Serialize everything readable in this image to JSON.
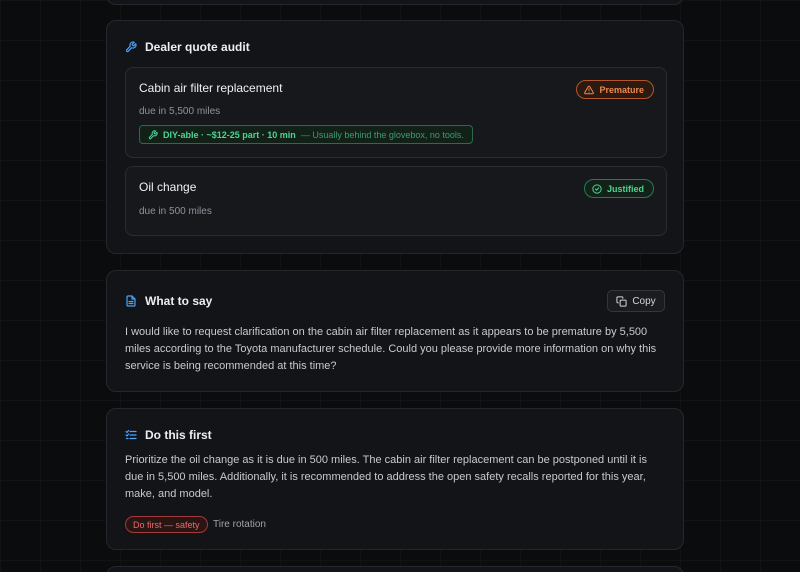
{
  "audit": {
    "title": "Dealer quote audit",
    "items": [
      {
        "title": "Cabin air filter replacement",
        "due": "due in 5,500 miles",
        "badge": "Premature",
        "diy_main": "DIY-able · ~$12-25 part · 10 min",
        "diy_note": "— Usually behind the glovebox, no tools."
      },
      {
        "title": "Oil change",
        "due": "due in 500 miles",
        "badge": "Justified"
      }
    ]
  },
  "say": {
    "title": "What to say",
    "copy_label": "Copy",
    "text": "I would like to request clarification on the cabin air filter replacement as it appears to be premature by 5,500 miles according to the Toyota manufacturer schedule. Could you please provide more information on why this service is being recommended at this time?"
  },
  "first": {
    "title": "Do this first",
    "text": "Prioritize the oil change as it is due in 500 miles. The cabin air filter replacement can be postponed until it is due in 5,500 miles. Additionally, it is recommended to address the open safety recalls reported for this year, make, and model.",
    "tags": [
      "Do first — safety",
      "Tire rotation"
    ]
  },
  "colors": {
    "accent": "#4aa3ff",
    "warning": "#f0884f",
    "success": "#4ed391",
    "danger": "#ec6a6a"
  },
  "icons": {
    "audit": "wrench-icon",
    "premature": "warning-triangle-icon",
    "justified": "check-circle-icon",
    "diy": "wrench-icon",
    "say": "document-icon",
    "copy": "copy-icon",
    "first": "checklist-icon"
  }
}
